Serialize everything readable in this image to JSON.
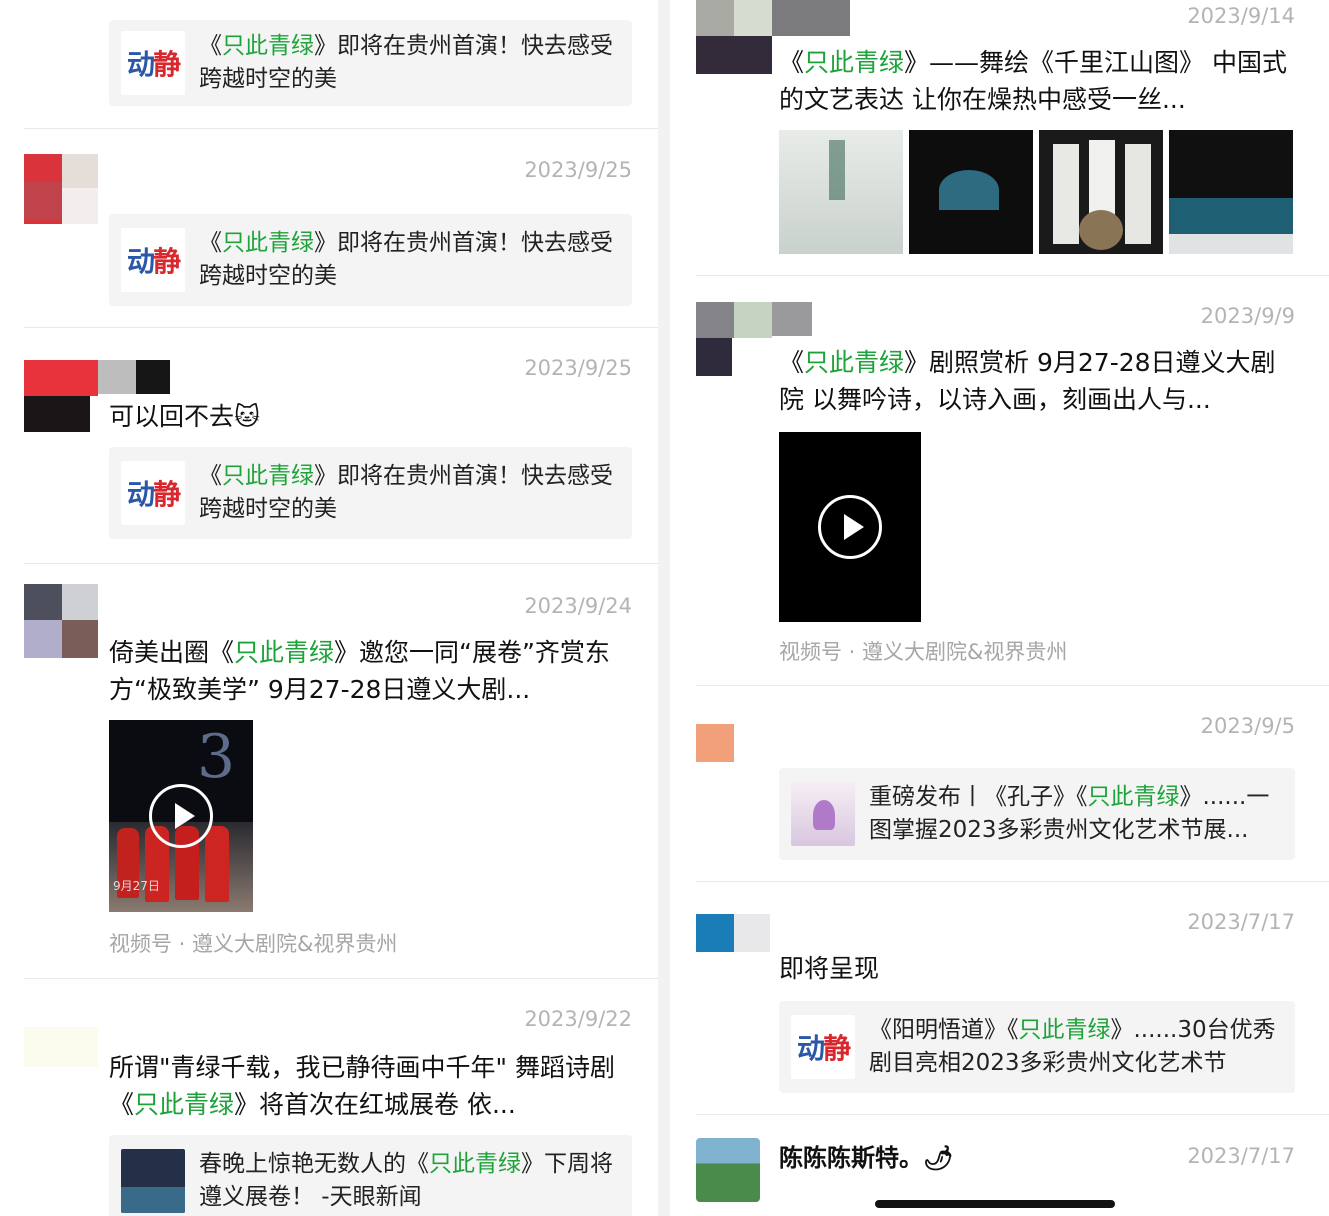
{
  "left": {
    "post0": {
      "card": {
        "t1": "《",
        "hl": "只此青绿",
        "t2": "》即将在贵州首演！快去感受跨越时空的美"
      }
    },
    "post1": {
      "date": "2023/9/25",
      "card": {
        "t1": "《",
        "hl": "只此青绿",
        "t2": "》即将在贵州首演！快去感受跨越时空的美"
      }
    },
    "post2": {
      "date": "2023/9/25",
      "text": "可以回不去",
      "emoji": "🐱",
      "card": {
        "t1": "《",
        "hl": "只此青绿",
        "t2": "》即将在贵州首演！快去感受跨越时空的美"
      }
    },
    "post3": {
      "date": "2023/9/24",
      "text": {
        "t1": "倚美出圈《",
        "hl": "只此青绿",
        "t2": "》邀您一同“展卷”齐赏东方“极致美学” 9月27-28日遵义大剧..."
      },
      "video_caption": "9月27日",
      "source": "视频号 · 遵义大剧院&视界贵州"
    },
    "post4": {
      "date": "2023/9/22",
      "text": {
        "t1": "所谓\"青绿千载，我已静待画中千年\" 舞蹈诗剧《",
        "hl": "只此青绿",
        "t2": "》将首次在红城展卷 依..."
      },
      "card": {
        "t1": "春晚上惊艳无数人的《",
        "hl": "只此青绿",
        "t2": "》下周将遵义展卷！ -天眼新闻"
      }
    }
  },
  "right": {
    "post0": {
      "date": "2023/9/14",
      "text": {
        "t1": "《",
        "hl": "只此青绿",
        "t2": "》——舞绘《千里江山图》 中国式的文艺表达 让你在燥热中感受一丝..."
      }
    },
    "post1": {
      "date": "2023/9/9",
      "text": {
        "t1": "《",
        "hl": "只此青绿",
        "t2": "》剧照赏析 9月27-28日遵义大剧院 以舞吟诗，以诗入画，刻画出人与..."
      },
      "source": "视频号 · 遵义大剧院&视界贵州"
    },
    "post2": {
      "date": "2023/9/5",
      "card": {
        "t1": "重磅发布丨《孔子》《",
        "hl": "只此青绿",
        "t2": "》......一图掌握2023多彩贵州文化艺术节展..."
      }
    },
    "post3": {
      "date": "2023/7/17",
      "text": "即将呈现",
      "card": {
        "t1": "《阳明悟道》《",
        "hl": "只此青绿",
        "t2": "》......30台优秀剧目亮相2023多彩贵州文化艺术节"
      }
    },
    "post4": {
      "date": "2023/7/17",
      "name": "陈陈陈斯特。",
      "emoji": "🌶"
    }
  },
  "logo": {
    "a": "动",
    "b": "静"
  },
  "colors": {
    "highlight": "#1ea33a",
    "date": "#b4b4b4",
    "card_bg": "#f4f4f4"
  }
}
